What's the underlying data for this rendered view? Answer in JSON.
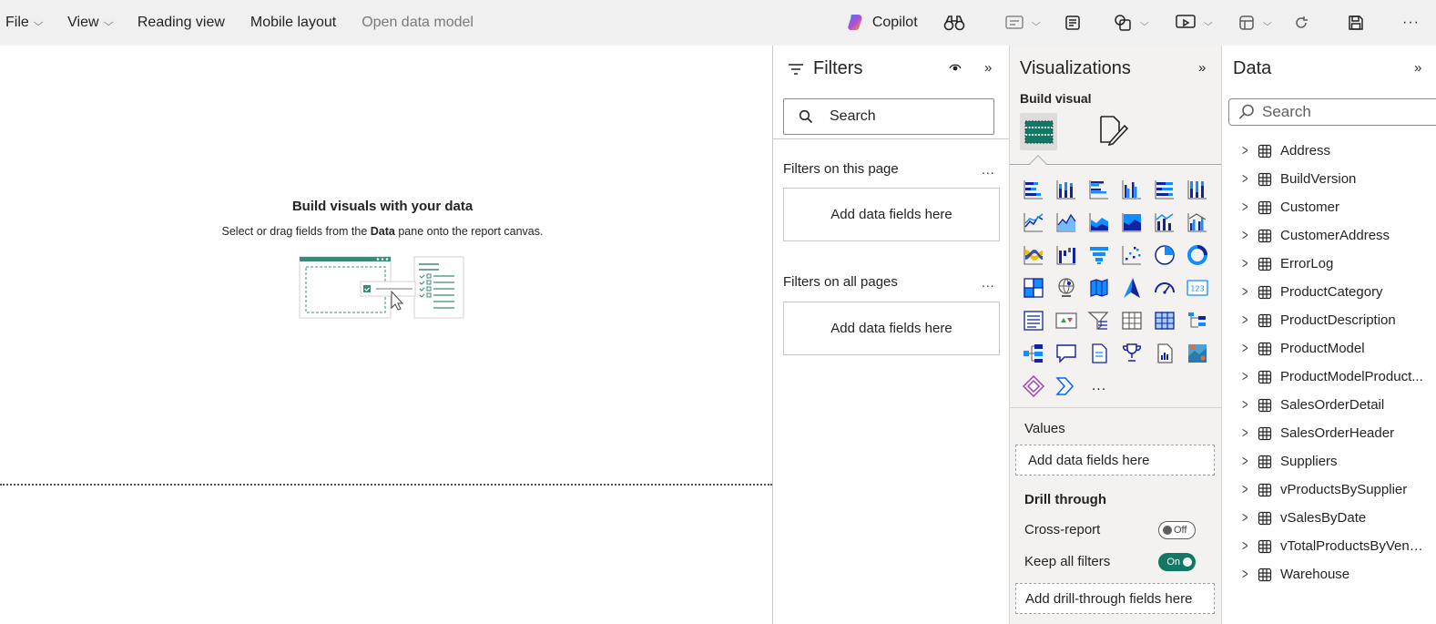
{
  "menu": {
    "file": "File",
    "view": "View",
    "reading_view": "Reading view",
    "mobile_layout": "Mobile layout",
    "open_data_model": "Open data model"
  },
  "toolbar": {
    "copilot": "Copilot"
  },
  "canvas": {
    "title": "Build visuals with your data",
    "subtitle_pre": "Select or drag fields from the ",
    "subtitle_bold": "Data",
    "subtitle_post": " pane onto the report canvas."
  },
  "filters": {
    "title": "Filters",
    "search_placeholder": "Search",
    "this_page": "Filters on this page",
    "all_pages": "Filters on all pages",
    "more": "...",
    "add_fields_1": "Add data fields here",
    "add_fields_2": "Add data fields here"
  },
  "visualizations": {
    "title": "Visualizations",
    "build_visual": "Build visual",
    "more": "...",
    "values_label": "Values",
    "values_add": "Add data fields here",
    "drill_through": "Drill through",
    "cross_report": "Cross-report",
    "cross_report_state": "Off",
    "keep_filters": "Keep all filters",
    "keep_filters_state": "On",
    "drill_add": "Add drill-through fields here",
    "icons": [
      "stacked-bar-chart-icon",
      "stacked-column-chart-icon",
      "clustered-bar-chart-icon",
      "clustered-column-chart-icon",
      "100-stacked-bar-chart-icon",
      "100-stacked-column-chart-icon",
      "line-chart-icon",
      "area-chart-icon",
      "stacked-area-chart-icon",
      "100-stacked-area-chart-icon",
      "line-and-stacked-column-chart-icon",
      "line-and-clustered-column-chart-icon",
      "ribbon-chart-icon",
      "waterfall-chart-icon",
      "funnel-chart-icon",
      "scatter-chart-icon",
      "pie-chart-icon",
      "donut-chart-icon",
      "treemap-icon",
      "map-icon",
      "filled-map-icon",
      "azure-map-icon",
      "gauge-icon",
      "card-icon",
      "multi-row-card-icon",
      "kpi-icon",
      "slicer-icon",
      "table-icon",
      "matrix-icon",
      "decomposition-tree-icon",
      "key-influencers-icon",
      "qna-icon",
      "smart-narrative-icon",
      "metrics-icon",
      "paginated-report-icon",
      "arcgis-map-icon",
      "power-apps-icon",
      "power-automate-icon"
    ]
  },
  "data": {
    "title": "Data",
    "search_placeholder": "Search",
    "tables": [
      "Address",
      "BuildVersion",
      "Customer",
      "CustomerAddress",
      "ErrorLog",
      "ProductCategory",
      "ProductDescription",
      "ProductModel",
      "ProductModelProduct...",
      "SalesOrderDetail",
      "SalesOrderHeader",
      "Suppliers",
      "vProductsBySupplier",
      "vSalesByDate",
      "vTotalProductsByVend...",
      "Warehouse"
    ]
  },
  "colors": {
    "accent": "#117865",
    "chart_blue": "#118dff",
    "chart_navy": "#12239e",
    "chart_orange": "#e66c37",
    "ribbon_bg": "#f0f0f0",
    "pane_bg": "#f3f2f1"
  }
}
